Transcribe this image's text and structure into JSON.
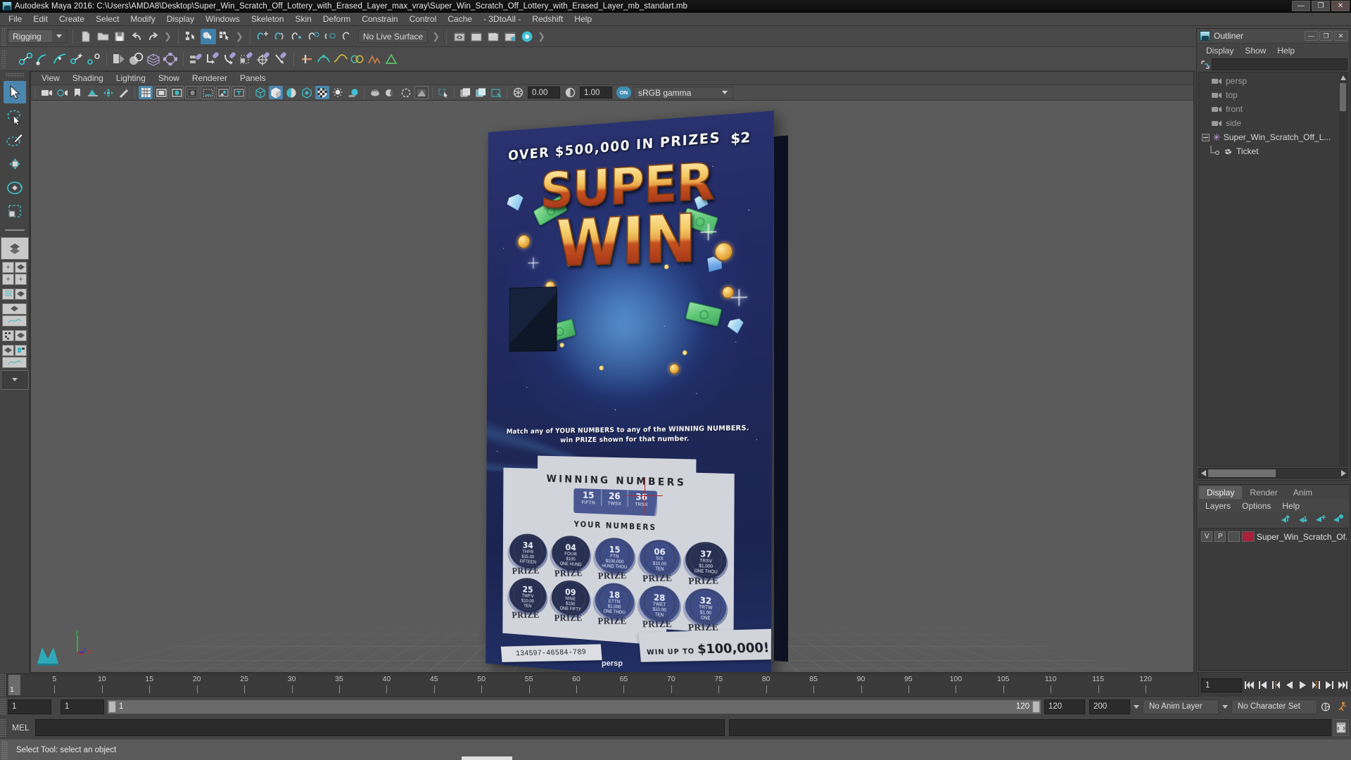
{
  "window": {
    "title": "Autodesk Maya 2016: C:\\Users\\AMDA8\\Desktop\\Super_Win_Scratch_Off_Lottery_with_Erased_Layer_max_vray\\Super_Win_Scratch_Off_Lottery_with_Erased_Layer_mb_standart.mb",
    "minimize": "—",
    "maximize": "❐",
    "close": "✕"
  },
  "menubar": {
    "items": [
      "File",
      "Edit",
      "Create",
      "Select",
      "Modify",
      "Display",
      "Windows",
      "Skeleton",
      "Skin",
      "Deform",
      "Constrain",
      "Control",
      "Cache",
      "- 3DtoAll -",
      "Redshift",
      "Help"
    ]
  },
  "shelf": {
    "menu_set": "Rigging",
    "live_surface": "No Live Surface",
    "ipr_label": "IPR"
  },
  "viewport_menu": {
    "items": [
      "View",
      "Shading",
      "Lighting",
      "Show",
      "Renderer",
      "Panels"
    ]
  },
  "viewport_toolbar": {
    "exposure": "0.00",
    "gamma": "1.00",
    "on_badge": "ON",
    "color_profile": "sRGB gamma"
  },
  "viewport": {
    "camera_label": "persp",
    "axis": {
      "x": "x",
      "y": "y",
      "z": "z"
    }
  },
  "ticket": {
    "overline": "OVER $500,000 IN PRIZES",
    "price": "$2",
    "logo_line1": "SUPER",
    "logo_line2": "WIN",
    "instructions_line1": "Match any of YOUR NUMBERS to any of the WINNING NUMBERS.",
    "instructions_line2": "win PRIZE shown for that number.",
    "winning_header": "WINNING NUMBERS",
    "winning_numbers": [
      {
        "num": "15",
        "word": "FIFTN"
      },
      {
        "num": "26",
        "word": "TWSX"
      },
      {
        "num": "36",
        "word": "TRSX"
      }
    ],
    "your_header": "YOUR NUMBERS",
    "your_numbers": [
      {
        "num": "34",
        "word": "THFR",
        "amount": "$15.00",
        "spell": "FIFTEEN",
        "prize": "PRIZE",
        "dark": true
      },
      {
        "num": "04",
        "word": "FOUR",
        "amount": "$100",
        "spell": "ONE HUND",
        "prize": "PRIZE",
        "dark": true
      },
      {
        "num": "15",
        "word": "FTN",
        "amount": "$100,000",
        "spell": "HUND THOU",
        "prize": "PRIZE",
        "dark": false
      },
      {
        "num": "06",
        "word": "SIX",
        "amount": "$10.00",
        "spell": "TEN",
        "prize": "PRIZE",
        "dark": false
      },
      {
        "num": "37",
        "word": "TRSV",
        "amount": "$1,000",
        "spell": "ONE THOU",
        "prize": "PRIZE",
        "dark": true
      },
      {
        "num": "25",
        "word": "TWFV",
        "amount": "$10.00",
        "spell": "TEN",
        "prize": "PRIZE",
        "dark": true
      },
      {
        "num": "09",
        "word": "NINE",
        "amount": "$150",
        "spell": "ONE FIFTY",
        "prize": "PRIZE",
        "dark": true
      },
      {
        "num": "18",
        "word": "ETTN",
        "amount": "$1,000",
        "spell": "ONE THOU",
        "prize": "PRIZE",
        "dark": false
      },
      {
        "num": "28",
        "word": "TWET",
        "amount": "$10.00",
        "spell": "TEN",
        "prize": "PRIZE",
        "dark": false
      },
      {
        "num": "32",
        "word": "TRTW",
        "amount": "$1.00",
        "spell": "ONE",
        "prize": "PRIZE",
        "dark": false
      }
    ],
    "win_up_to_small": "WIN UP TO",
    "win_up_to_big": "$100,000!",
    "serial": "134597-46584-789"
  },
  "outliner": {
    "title": "Outliner",
    "menu": [
      "Display",
      "Show",
      "Help"
    ],
    "search_value": "",
    "items": [
      {
        "label": "persp",
        "type": "camera"
      },
      {
        "label": "top",
        "type": "camera"
      },
      {
        "label": "front",
        "type": "camera"
      },
      {
        "label": "side",
        "type": "camera"
      },
      {
        "label": "Super_Win_Scratch_Off_L...",
        "type": "transform"
      },
      {
        "label": "Ticket",
        "type": "mesh"
      }
    ]
  },
  "layer_editor": {
    "tabs": [
      "Display",
      "Render",
      "Anim"
    ],
    "active_tab": "Display",
    "menu": [
      "Layers",
      "Options",
      "Help"
    ],
    "layers": [
      {
        "visibility": "V",
        "playback": "P",
        "state": "",
        "color": "#a8203a",
        "name": "Super_Win_Scratch_Of..."
      }
    ]
  },
  "timeline": {
    "ticks": [
      5,
      10,
      15,
      20,
      25,
      30,
      35,
      40,
      45,
      50,
      55,
      60,
      65,
      70,
      75,
      80,
      85,
      90,
      95,
      100,
      105,
      110,
      115,
      120
    ],
    "current_frame": "1",
    "current_frame_field": "1"
  },
  "range": {
    "start": "1",
    "playback_start": "1",
    "slider_start": "1",
    "slider_end": "120",
    "playback_end": "120",
    "end": "200",
    "anim_layer": "No Anim Layer",
    "character_set": "No Character Set"
  },
  "command_line": {
    "label": "MEL",
    "input_value": "",
    "output_value": ""
  },
  "status": {
    "help_text": "Select Tool: select an object"
  },
  "colors": {
    "accent": "#4a86ad",
    "panel_bg": "#444444",
    "viewport_bg": "#5b5b5b",
    "layer_color": "#a8203a"
  }
}
